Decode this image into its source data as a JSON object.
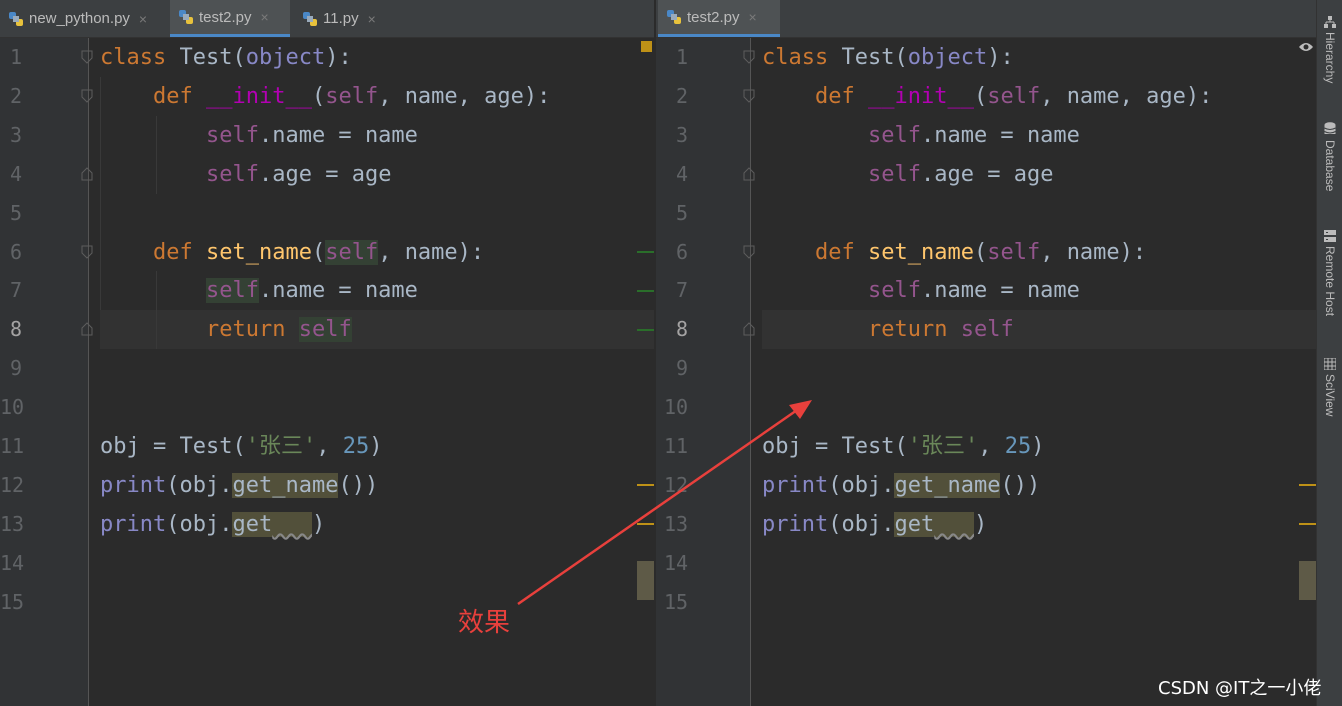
{
  "left_tabs": [
    {
      "label": "new_python.py",
      "active": false
    },
    {
      "label": "test2.py",
      "active": true
    },
    {
      "label": "11.py",
      "active": false
    }
  ],
  "right_tabs": [
    {
      "label": "test2.py",
      "active": true
    }
  ],
  "close_glyph": "×",
  "line_numbers": [
    "1",
    "2",
    "3",
    "4",
    "5",
    "6",
    "7",
    "8",
    "9",
    "10",
    "11",
    "12",
    "13",
    "14",
    "15"
  ],
  "current_line": "8",
  "code": {
    "class_kw": "class",
    "class_name": "Test",
    "base": "object",
    "def_kw": "def",
    "init_name": "__init__",
    "self_kw": "self",
    "param_name": "name",
    "param_age": "age",
    "attr_name": "name",
    "attr_age": "age",
    "setname_fn": "set_name",
    "return_kw": "return",
    "obj_var": "obj",
    "arg_str": "'张三'",
    "arg_num": "25",
    "print_fn": "print",
    "get_name_call": "get_name",
    "get_partial": "get"
  },
  "right_toolbar": [
    "Hierarchy",
    "Database",
    "Remote Host",
    "SciView"
  ],
  "annotation": "效果",
  "watermark": "CSDN @IT之一小佬",
  "colors": {
    "background": "#2b2b2b",
    "keyword": "#cc7832",
    "self": "#94558d",
    "function": "#ffc66d",
    "string": "#6a8759",
    "number": "#6897bb",
    "arrow": "#e8403c"
  },
  "icons": {
    "file": "python-file-icon",
    "eye": "eye-icon",
    "hierarchy": "hierarchy-icon",
    "database": "database-icon",
    "remote": "remote-host-icon",
    "sciview": "sciview-icon"
  }
}
